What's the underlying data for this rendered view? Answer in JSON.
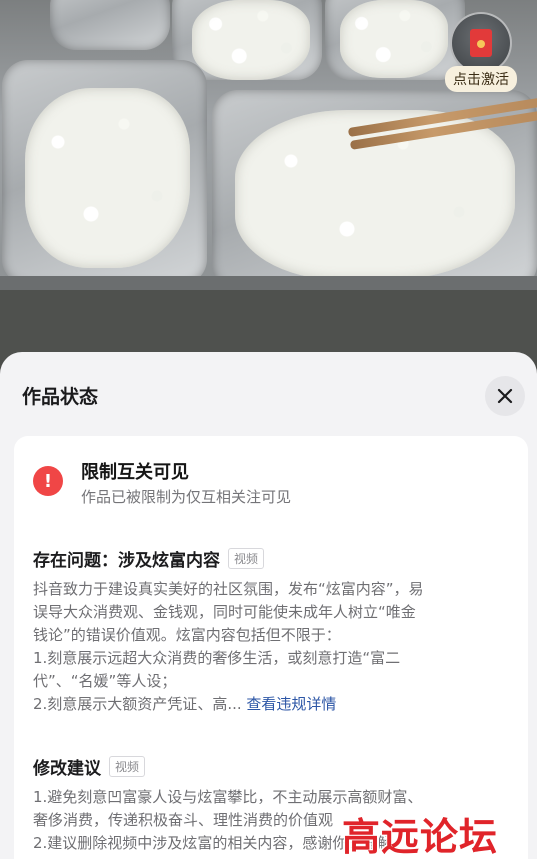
{
  "photo": {
    "activate_label": "点击激活",
    "activate_icon": "red-envelope-icon"
  },
  "sheet": {
    "title": "作品状态",
    "close_icon": "close-icon",
    "status": {
      "icon": "exclamation-icon",
      "title": "限制互关可见",
      "subtitle": "作品已被限制为仅互相关注可见"
    },
    "issue": {
      "heading": "存在问题：涉及炫富内容",
      "tag": "视频",
      "lines": [
        "抖音致力于建设真实美好的社区氛围，发布“炫富内容”，易",
        "误导大众消费观、金钱观，同时可能使未成年人树立“唯金",
        "钱论”的错误价值观。炫富内容包括但不限于：",
        "1.刻意展示远超大众消费的奢侈生活，或刻意打造“富二",
        "代”、“名媛”等人设；"
      ],
      "last_line": "2.刻意展示大额资产凭证、高...",
      "detail_link": "查看违规详情"
    },
    "suggestion": {
      "heading": "修改建议",
      "tag": "视频",
      "lines": [
        "1.避免刻意凹富豪人设与炫富攀比，不主动展示高额财富、",
        "奢侈消费，传递积极奋斗、理性消费的价值观",
        "2.建议删除视频中涉及炫富的相关内容，感谢你的理解"
      ]
    }
  },
  "watermark": "高远论坛"
}
